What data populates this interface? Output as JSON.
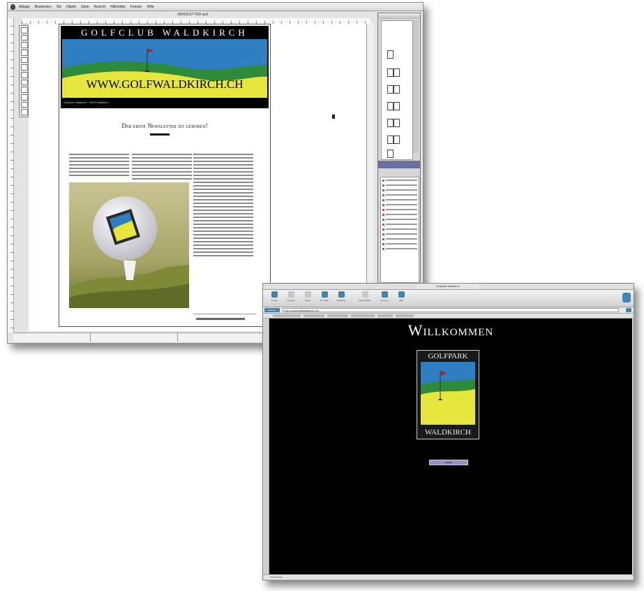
{
  "layout_app": {
    "menu_items": [
      "Ablage",
      "Bearbeiten",
      "Stil",
      "Objekt",
      "Seite",
      "Ansicht",
      "Hilfsmittel",
      "Fenster",
      "Hilfe"
    ],
    "document_title": "NEWSLETTER.qxd"
  },
  "newsletter": {
    "club_name": "GOLFCLUB WALDKIRCH",
    "website": "WWW.GOLFWALDKIRCH.CH",
    "header_subline": "Golfpark Waldkirch · 9205 Waldkirch",
    "title": "Der erste Newsletter ist geboren!"
  },
  "browser": {
    "window_title": "Golfpark Waldkirch",
    "toolbar_buttons": [
      "Zurück",
      "Vorwärts",
      "Stopp",
      "Neu laden",
      "Startseite",
      "AutoAusfüllen",
      "Drucken",
      "Mail"
    ],
    "address_label": "Adresse",
    "address_url": "http://www.golfwaldkirch.ch/",
    "welcome_title": "Willkommen",
    "logo_top": "GOLFPARK",
    "logo_bottom": "WALDKIRCH",
    "enter_button": "ENTER",
    "status": "Internet-Zone"
  },
  "colors": {
    "sky_blue": "#2f7ec0",
    "hill_green": "#2e8b3a",
    "fairway_yellow": "#e6e63c",
    "web_background": "#000000",
    "palette_title": "#6a6fa4"
  }
}
